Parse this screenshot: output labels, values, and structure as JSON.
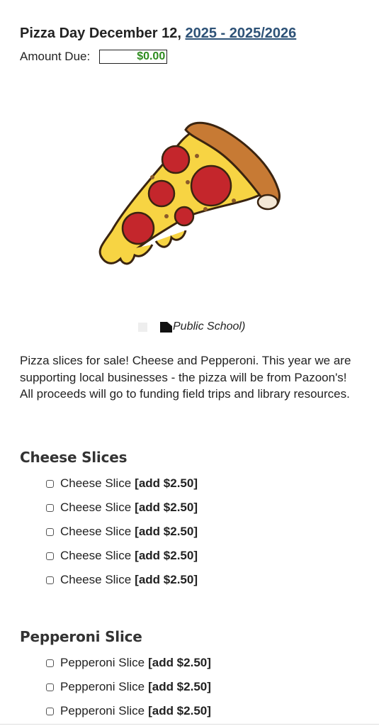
{
  "header": {
    "title_prefix": "Pizza Day December 12, ",
    "title_link": "2025 - 2025/2026",
    "amount_label": "Amount Due:",
    "amount_value": "$0.00",
    "amount_color": "#2e8b1f"
  },
  "image": {
    "icon": "pizza-slice-illustration",
    "caption": "Public School)"
  },
  "description": "Pizza slices for sale! Cheese and Pepperoni. This year we are supporting local businesses - the pizza will be from Pazoon's! All proceeds will go to funding field trips and library resources.",
  "cheese": {
    "heading": "Cheese Slices",
    "options": [
      {
        "label": "Cheese Slice",
        "price": "[add $2.50]",
        "checked": false
      },
      {
        "label": "Cheese Slice",
        "price": "[add $2.50]",
        "checked": false
      },
      {
        "label": "Cheese Slice",
        "price": "[add $2.50]",
        "checked": false
      },
      {
        "label": "Cheese Slice",
        "price": "[add $2.50]",
        "checked": false
      },
      {
        "label": "Cheese Slice",
        "price": "[add $2.50]",
        "checked": false
      }
    ]
  },
  "pepperoni": {
    "heading": "Pepperoni Slice",
    "options": [
      {
        "label": "Pepperoni Slice",
        "price": "[add $2.50]",
        "checked": false
      },
      {
        "label": "Pepperoni Slice",
        "price": "[add $2.50]",
        "checked": false
      },
      {
        "label": "Pepperoni Slice",
        "price": "[add $2.50]",
        "checked": false
      }
    ]
  }
}
